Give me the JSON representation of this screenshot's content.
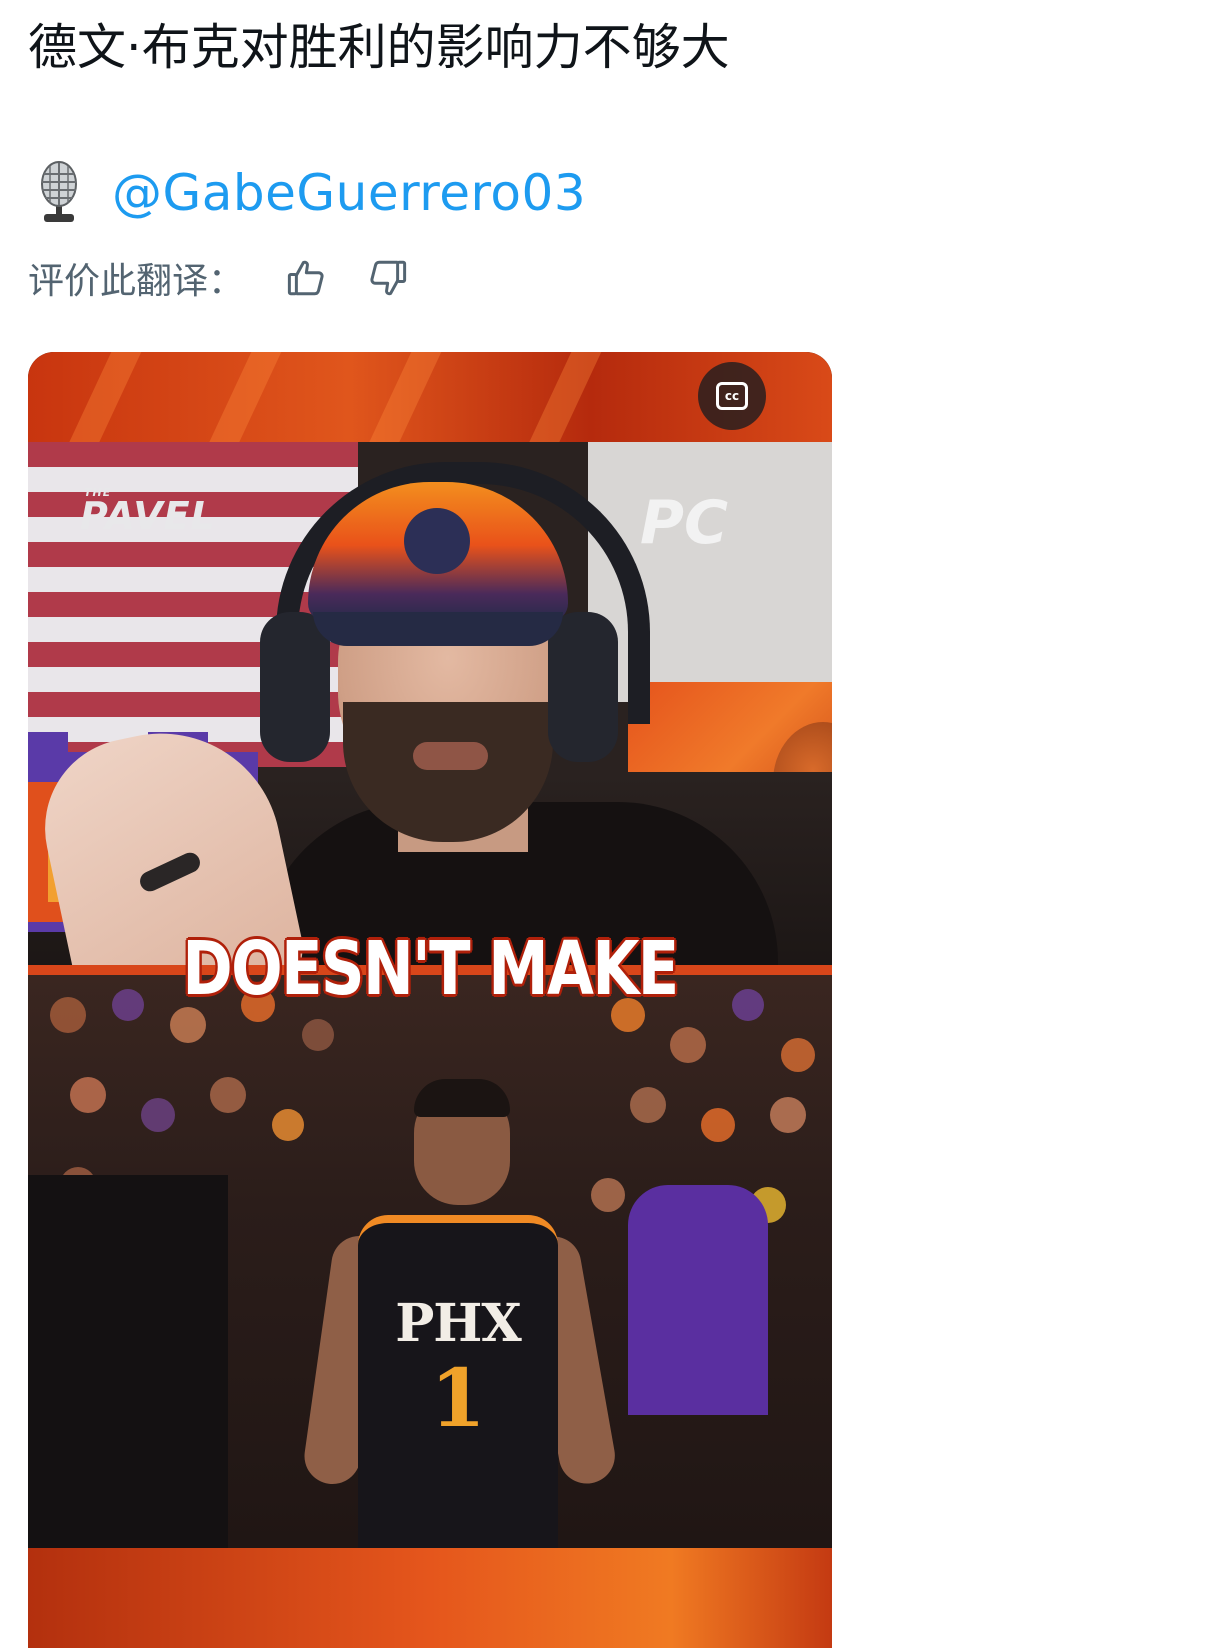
{
  "post": {
    "text": "德文·布克对胜利的影响力不够大",
    "mention": "@GabeGuerrero03"
  },
  "translation_rating": {
    "label": "评价此翻译："
  },
  "video": {
    "caption": "DOESN'T MAKE",
    "logo_left": "PAVEL",
    "logo_left_prefix": "THE",
    "logo_right": "PC",
    "cc_label": "cc",
    "jersey_team": "PHX",
    "jersey_number": "1"
  },
  "icons": {
    "mic": "studio-microphone-emoji",
    "thumbs_up": "thumbs-up-icon",
    "thumbs_down": "thumbs-down-icon",
    "captions": "closed-captions-icon"
  },
  "colors": {
    "link": "#1d9bf0",
    "text": "#0f1419",
    "secondary": "#536471",
    "suns_orange": "#e5561c",
    "suns_purple": "#5a2fa0"
  }
}
